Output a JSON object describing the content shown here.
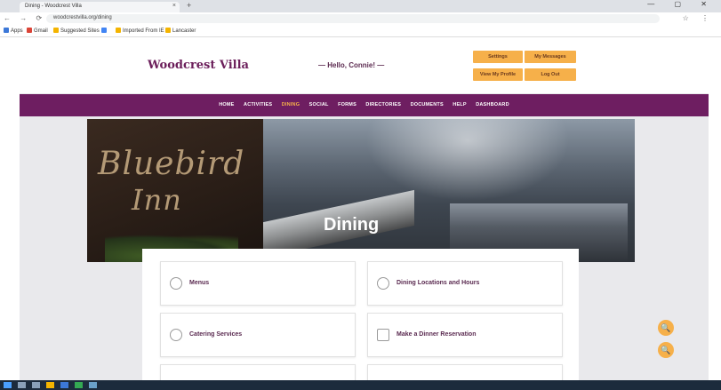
{
  "browser": {
    "tab_title": "Dining - Woodcrest Villa",
    "tab_close": "×",
    "new_tab": "+",
    "window_controls": "— ▢ ✕",
    "nav_buttons": "← → ⟳ ⌂",
    "url": "woodcrestvilla.org/dining",
    "addr_right_icons": "☆ ⋮",
    "bookmarks": [
      {
        "label": "Apps",
        "color": "#3c78d8"
      },
      {
        "label": "Gmail",
        "color": "#db4437"
      },
      {
        "label": "Suggested Sites",
        "color": "#f4b400"
      },
      {
        "label": "",
        "color": "#4285f4"
      },
      {
        "label": "Imported From IE",
        "color": "#f4b400"
      },
      {
        "label": "Lancaster",
        "color": "#f4b400"
      }
    ]
  },
  "site": {
    "logo": "Woodcrest Villa",
    "greeting": "— Hello, Connie! —",
    "header_buttons": {
      "settings": "Settings",
      "my_messages": "My Messages",
      "view_my_profile": "View My Profile",
      "log_out": "Log Out"
    },
    "nav": [
      {
        "label": "HOME",
        "active": false
      },
      {
        "label": "ACTIVITIES",
        "active": false
      },
      {
        "label": "DINING",
        "active": true
      },
      {
        "label": "SOCIAL",
        "active": false
      },
      {
        "label": "FORMS",
        "active": false
      },
      {
        "label": "DIRECTORIES",
        "active": false
      },
      {
        "label": "DOCUMENTS",
        "active": false
      },
      {
        "label": "HELP",
        "active": false
      },
      {
        "label": "DASHBOARD",
        "active": false
      }
    ],
    "hero": {
      "sign_line1": "Bluebird",
      "sign_line2": "Inn",
      "title": "Dining"
    },
    "cards": [
      {
        "label": "Menus",
        "icon": "menu-icon"
      },
      {
        "label": "Dining Locations and Hours",
        "icon": "clock-icon"
      },
      {
        "label": "Catering Services",
        "icon": "catering-icon"
      },
      {
        "label": "Make a Dinner Reservation",
        "icon": "reservation-icon"
      }
    ],
    "fabs": {
      "zoom_in": "🔍",
      "zoom_out": "🔍"
    }
  },
  "colors": {
    "brand_purple": "#6e1e61",
    "accent_orange": "#f6b04a",
    "taskbar": "#1c2b3c"
  }
}
